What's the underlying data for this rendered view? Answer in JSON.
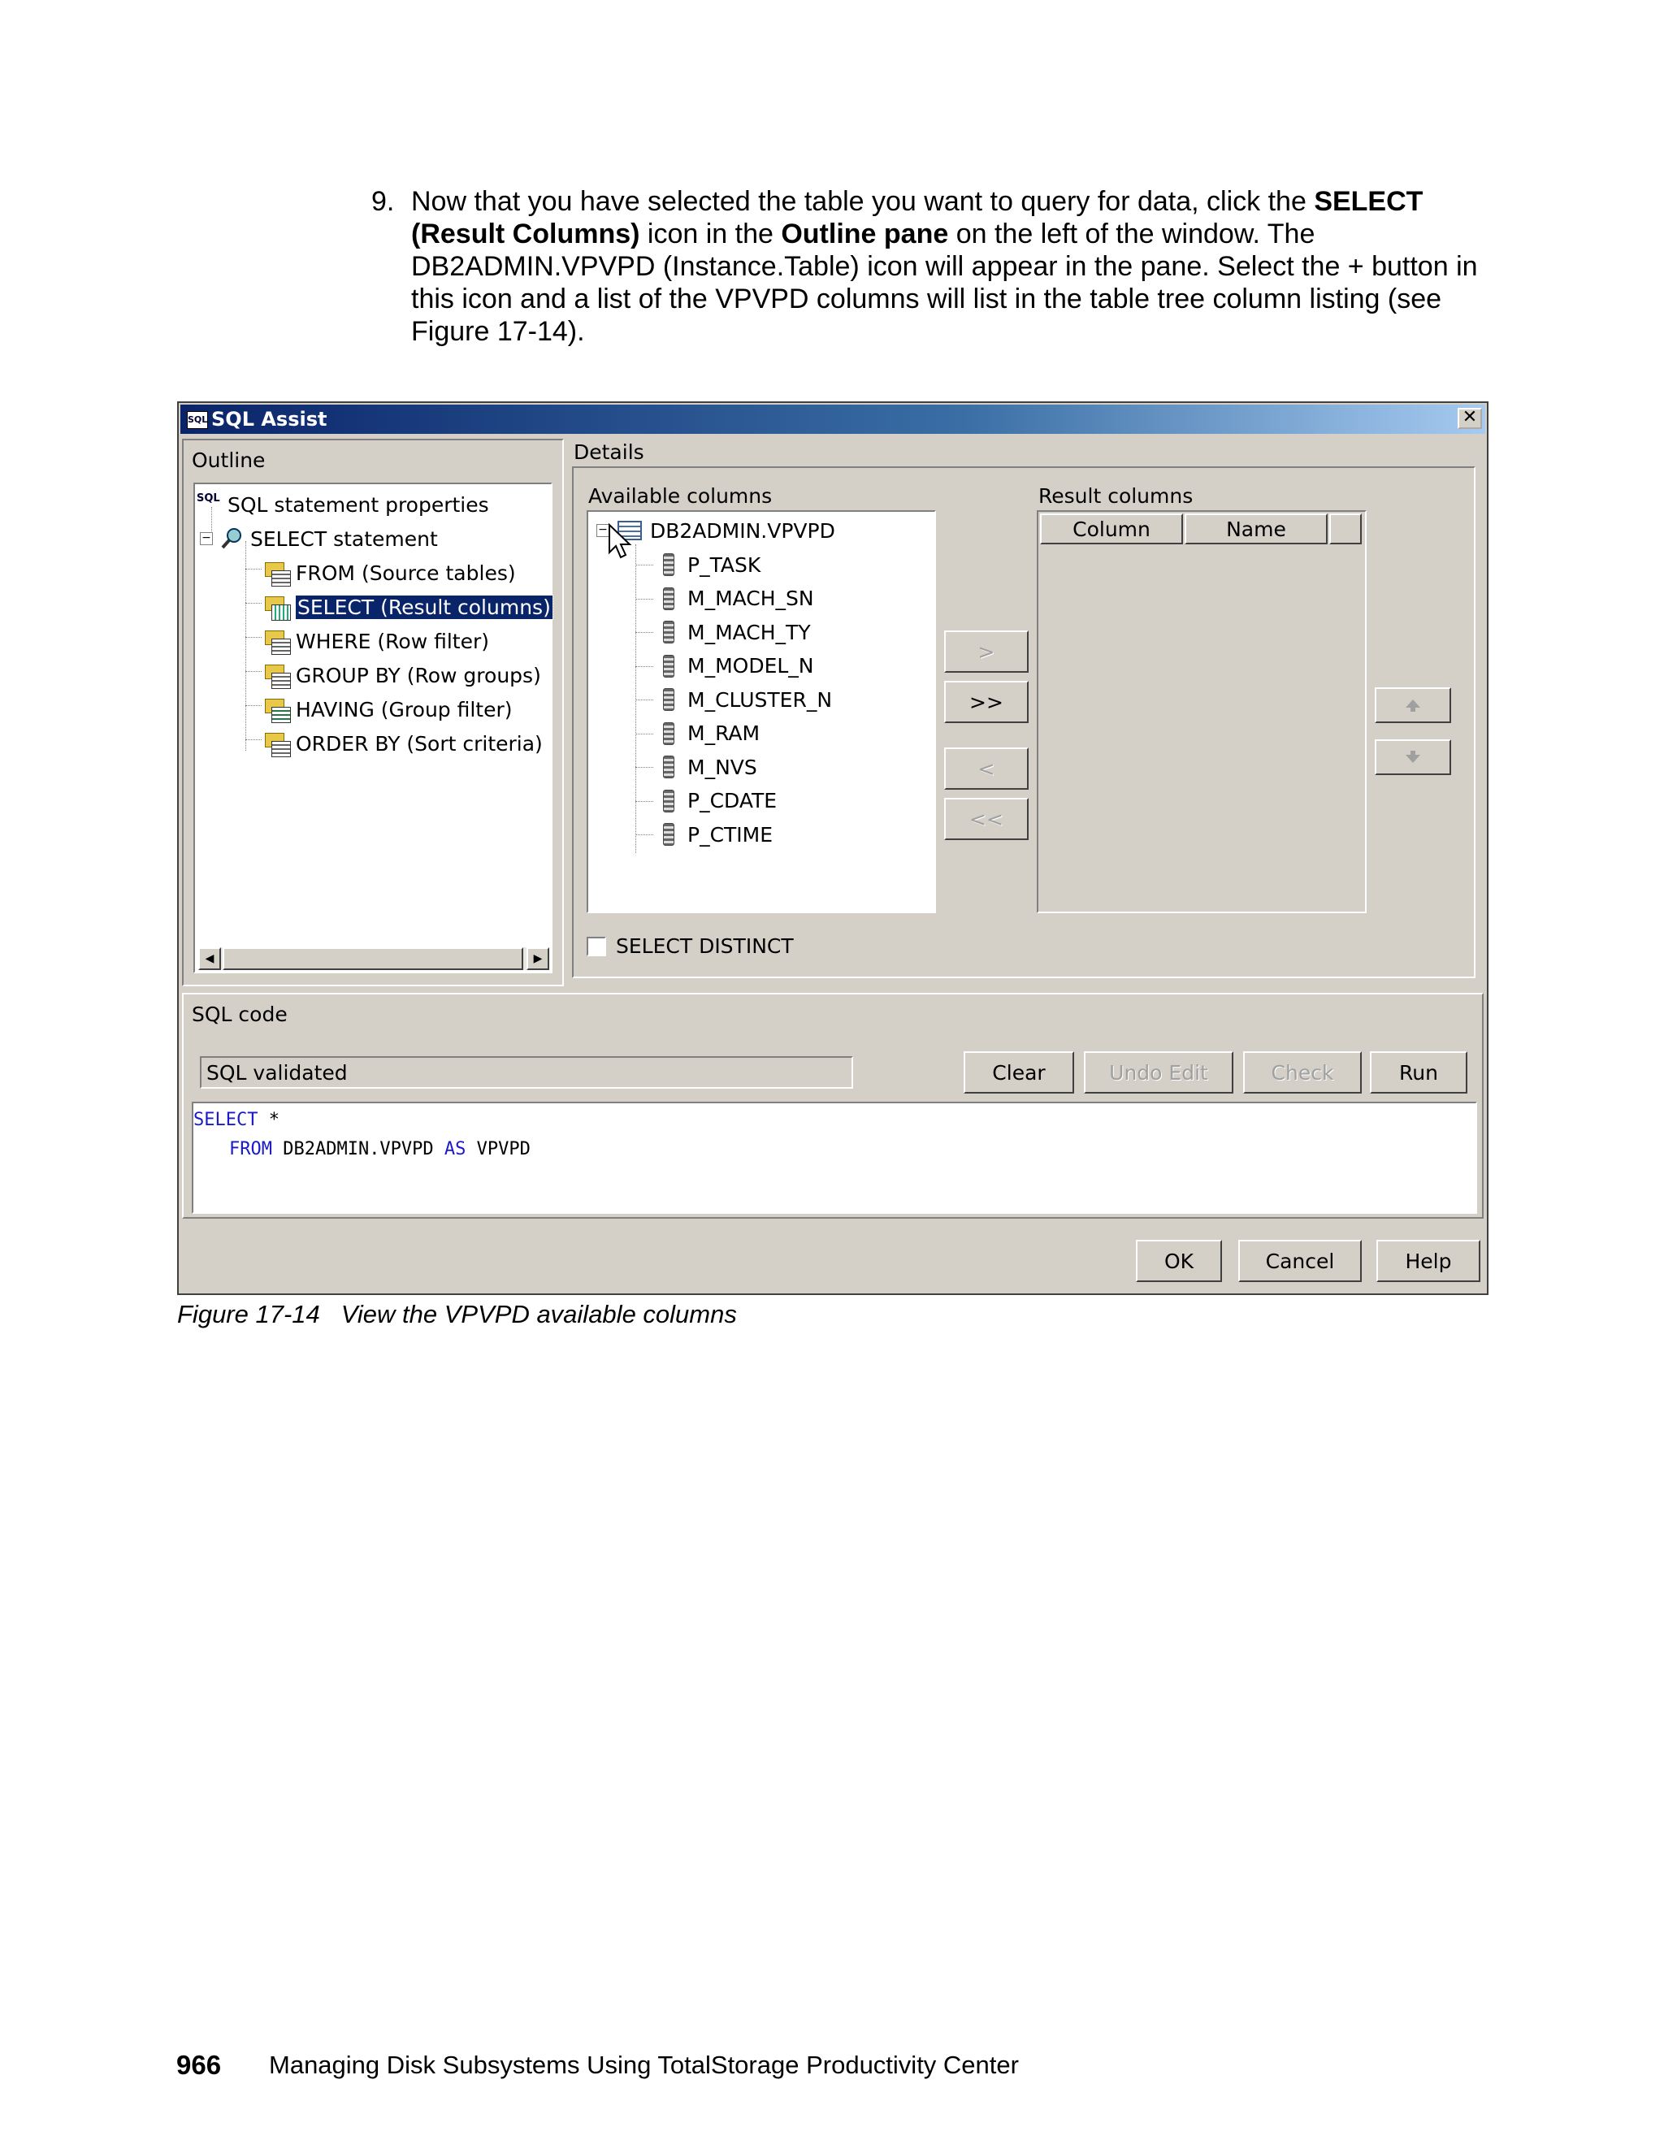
{
  "step": {
    "number": "9.",
    "t1": "Now that you have selected the table you want to query for data, click the ",
    "b1": "SELECT (Result Columns)",
    "t2": " icon in the ",
    "b2": "Outline pane",
    "t3": " on the left of the window. The DB2ADMIN.VPVPD (Instance.Table) icon will appear in the pane. Select the + button in this icon and a list of the VPVPD columns will list in the table tree column listing (see Figure 17-14)."
  },
  "window": {
    "title": "SQL Assist",
    "title_icon": "SQL",
    "close": "✕"
  },
  "outline": {
    "label": "Outline",
    "items": [
      {
        "label": "SQL statement properties"
      },
      {
        "label": "SELECT statement"
      },
      {
        "label": "FROM (Source tables)"
      },
      {
        "label": "SELECT (Result columns)"
      },
      {
        "label": "WHERE (Row filter)"
      },
      {
        "label": "GROUP BY (Row groups)"
      },
      {
        "label": "HAVING (Group filter)"
      },
      {
        "label": "ORDER BY (Sort criteria)"
      }
    ]
  },
  "details": {
    "label": "Details",
    "available_label": "Available columns",
    "table": "DB2ADMIN.VPVPD",
    "columns": [
      "P_TASK",
      "M_MACH_SN",
      "M_MACH_TY",
      "M_MODEL_N",
      "M_CLUSTER_N",
      "M_RAM",
      "M_NVS",
      "P_CDATE",
      "P_CTIME"
    ],
    "move_buttons": [
      ">",
      ">>",
      "<",
      "<<"
    ],
    "result_label": "Result columns",
    "result_headers": [
      "Column",
      "Name"
    ],
    "distinct_label": "SELECT DISTINCT"
  },
  "sqlcode": {
    "label": "SQL code",
    "status": "SQL validated",
    "buttons": [
      "Clear",
      "Undo Edit",
      "Check",
      "Run"
    ],
    "line1_kw": "SELECT",
    "line1_rest": " *",
    "line2_kw1": "FROM",
    "line2_mid": " DB2ADMIN.VPVPD ",
    "line2_kw2": "AS",
    "line2_rest": " VPVPD"
  },
  "footer_buttons": [
    "OK",
    "Cancel",
    "Help"
  ],
  "caption": {
    "figure": "Figure 17-14",
    "text": "View the VPVPD available columns"
  },
  "page_footer": {
    "page": "966",
    "book": "Managing Disk Subsystems Using TotalStorage Productivity Center"
  }
}
